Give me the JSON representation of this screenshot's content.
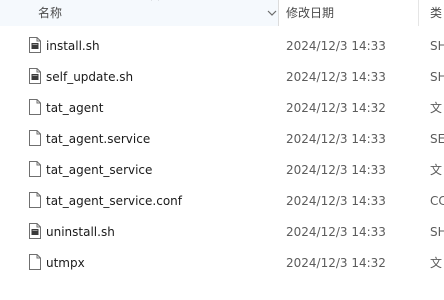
{
  "columns": {
    "name": "名称",
    "modified": "修改日期",
    "type": "类"
  },
  "icons": {
    "sort": "chevron-up-icon",
    "dropdown": "chevron-down-icon",
    "script_file": "script-file-icon",
    "plain_file": "blank-file-icon"
  },
  "files": [
    {
      "name": "install.sh",
      "modified": "2024/12/3 14:33",
      "type": "SH",
      "icon": "script"
    },
    {
      "name": "self_update.sh",
      "modified": "2024/12/3 14:33",
      "type": "SH",
      "icon": "script"
    },
    {
      "name": "tat_agent",
      "modified": "2024/12/3 14:32",
      "type": "文",
      "icon": "plain"
    },
    {
      "name": "tat_agent.service",
      "modified": "2024/12/3 14:33",
      "type": "SE",
      "icon": "plain"
    },
    {
      "name": "tat_agent_service",
      "modified": "2024/12/3 14:33",
      "type": "文",
      "icon": "plain"
    },
    {
      "name": "tat_agent_service.conf",
      "modified": "2024/12/3 14:33",
      "type": "CC",
      "icon": "plain"
    },
    {
      "name": "uninstall.sh",
      "modified": "2024/12/3 14:33",
      "type": "SH",
      "icon": "script"
    },
    {
      "name": "utmpx",
      "modified": "2024/12/3 14:32",
      "type": "文",
      "icon": "plain"
    }
  ]
}
